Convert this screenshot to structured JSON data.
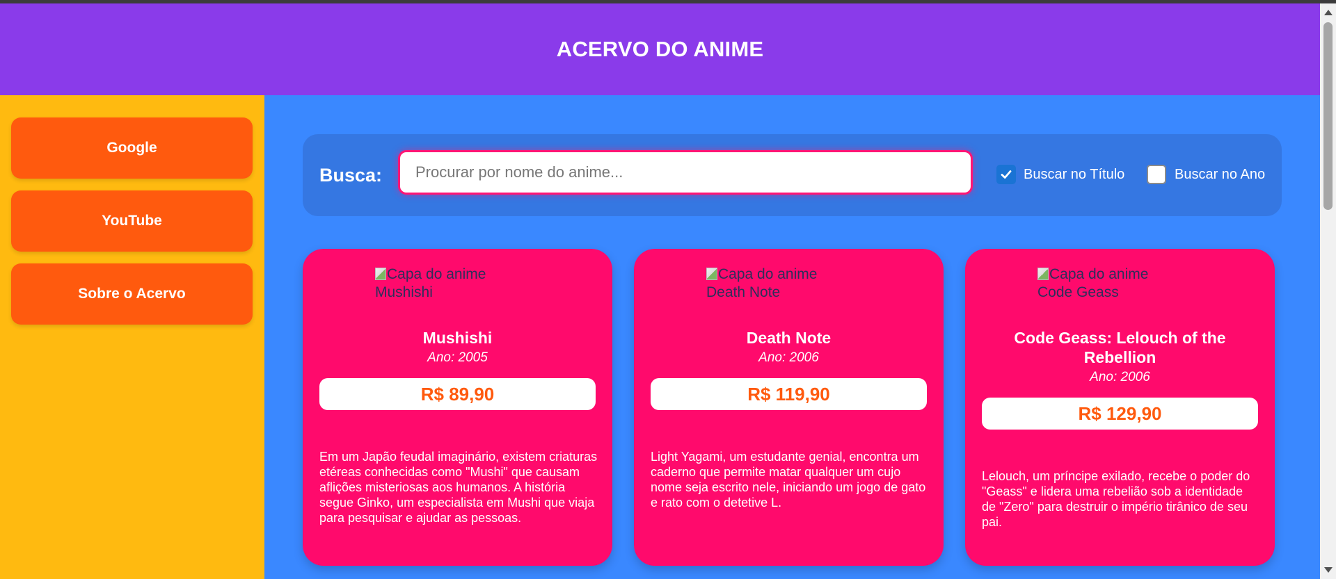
{
  "header": {
    "title": "ACERVO DO ANIME"
  },
  "sidebar": {
    "items": [
      {
        "label": "Google"
      },
      {
        "label": "YouTube"
      },
      {
        "label": "Sobre o Acervo"
      }
    ]
  },
  "search": {
    "label": "Busca:",
    "placeholder": "Procurar por nome do anime...",
    "value": "",
    "options": [
      {
        "label": "Buscar no Título",
        "checked": true
      },
      {
        "label": "Buscar no Ano",
        "checked": false
      }
    ]
  },
  "cards": [
    {
      "image_alt": "Capa do anime Mushishi",
      "title": "Mushishi",
      "year": "Ano: 2005",
      "price": "R$ 89,90",
      "description": "Em um Japão feudal imaginário, existem criaturas etéreas conhecidas como \"Mushi\" que causam aflições misteriosas aos humanos. A história segue Ginko, um especialista em Mushi que viaja para pesquisar e ajudar as pessoas."
    },
    {
      "image_alt": "Capa do anime Death Note",
      "title": "Death Note",
      "year": "Ano: 2006",
      "price": "R$ 119,90",
      "description": "Light Yagami, um estudante genial, encontra um caderno que permite matar qualquer um cujo nome seja escrito nele, iniciando um jogo de gato e rato com o detetive L."
    },
    {
      "image_alt": "Capa do anime Code Geass",
      "title": "Code Geass: Lelouch of the Rebellion",
      "year": "Ano: 2006",
      "price": "R$ 129,90",
      "description": "Lelouch, um príncipe exilado, recebe o poder do \"Geass\" e lidera uma rebelião sob a identidade de \"Zero\" para destruir o império tirânico de seu pai."
    }
  ],
  "colors": {
    "header": "#8a3bea",
    "sidebar": "#ffba10",
    "main": "#3a88ff",
    "nav_button": "#ff5a0e",
    "card": "#ff0a6c",
    "price_text": "#ff5a0e",
    "checkbox": "#1a73d4"
  }
}
